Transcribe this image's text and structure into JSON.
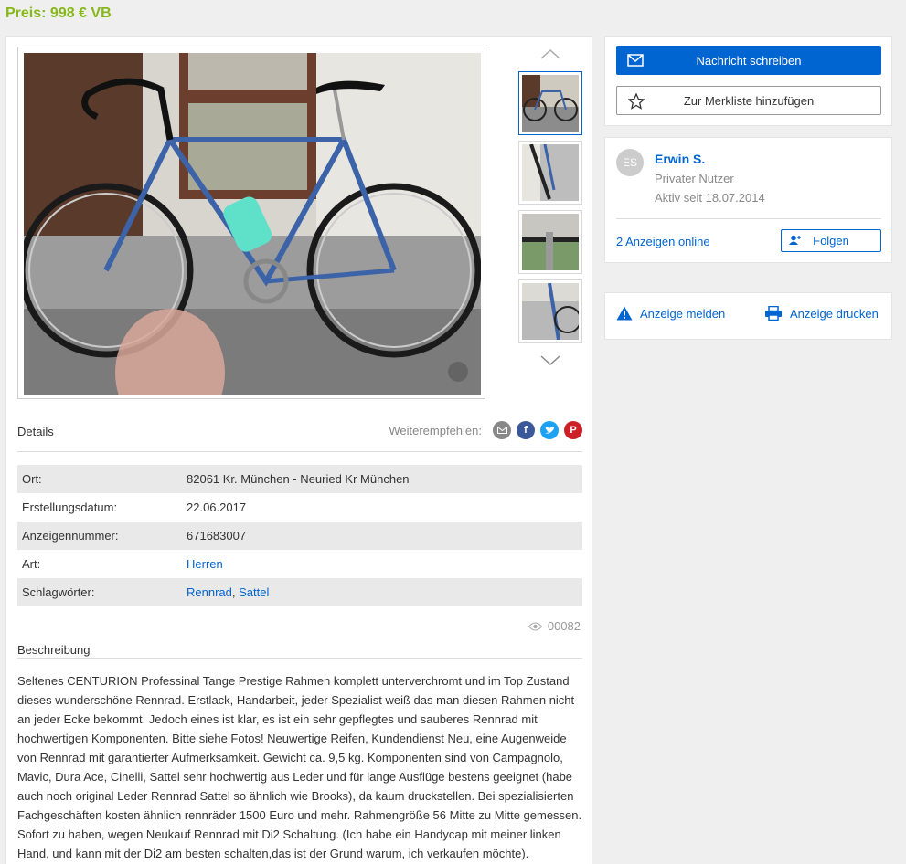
{
  "header": {
    "price": "Preis: 998 € VB"
  },
  "gallery": {
    "thumbnails": [
      {
        "name": "bike-full"
      },
      {
        "name": "fork-detail"
      },
      {
        "name": "handlebar-detail"
      },
      {
        "name": "frame-detail"
      }
    ]
  },
  "details": {
    "title": "Details",
    "share_label": "Weiterempfehlen:",
    "rows": [
      {
        "key": "Ort:",
        "value": "82061 Kr. München - Neuried Kr München"
      },
      {
        "key": "Erstellungsdatum:",
        "value": "22.06.2017"
      },
      {
        "key": "Anzeigennummer:",
        "value": "671683007"
      },
      {
        "key": "Art:",
        "value": "Herren"
      },
      {
        "key": "Schlagwörter:",
        "tags": [
          "Rennrad",
          "Sattel"
        ],
        "separator": ", "
      }
    ],
    "views": "00082"
  },
  "description": {
    "title": "Beschreibung",
    "text": "Seltenes CENTURION Professinal Tange Prestige Rahmen komplett unterverchromt und im Top Zustand dieses wunderschöne Rennrad. Erstlack, Handarbeit, jeder Spezialist weiß das man diesen Rahmen nicht an jeder Ecke bekommt. Jedoch eines ist klar, es ist ein sehr gepflegtes und sauberes Rennrad mit hochwertigen Komponenten. Bitte siehe Fotos! Neuwertige Reifen, Kundendienst Neu, eine Augenweide von Rennrad mit garantierter Aufmerksamkeit. Gewicht ca. 9,5 kg. Komponenten sind von Campagnolo, Mavic, Dura Ace, Cinelli, Sattel sehr hochwertig aus Leder und für lange Ausflüge bestens geeignet (habe auch noch original Leder Rennrad Sattel so ähnlich wie Brooks), da kaum druckstellen. Bei spezialisierten Fachgeschäften kosten ähnlich rennräder 1500 Euro und mehr. Rahmengröße 56 Mitte zu Mitte gemessen. Sofort zu haben, wegen Neukauf Rennrad mit Di2 Schaltung. (Ich habe ein Handycap mit meiner linken Hand, und kann mit der Di2 am besten schalten,das ist der Grund warum, ich verkaufen möchte)."
  },
  "contact": {
    "message_button": "Nachricht schreiben",
    "watchlist_button": "Zur Merkliste hinzufügen"
  },
  "seller": {
    "initials": "ES",
    "name": "Erwin S.",
    "type": "Privater Nutzer",
    "active_since": "Aktiv seit 18.07.2014",
    "ads_online": "2 Anzeigen online",
    "follow_button": "Folgen"
  },
  "actions": {
    "report": "Anzeige melden",
    "print": "Anzeige drucken"
  },
  "colors": {
    "price": "#86b817",
    "primary": "#0065d1",
    "email": "#888888",
    "facebook": "#3b5998",
    "twitter": "#1da1f2",
    "pinterest": "#cb2027"
  }
}
